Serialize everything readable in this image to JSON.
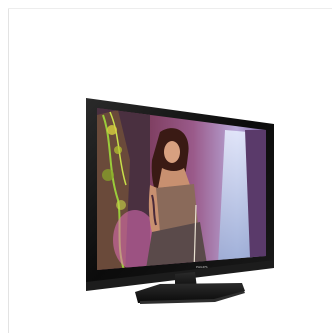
{
  "product": {
    "image_subject": "flat-screen-tv",
    "brand_mark": "PHILIPS"
  },
  "colors": {
    "bezel": "#0d0d0d",
    "stand": "#111111",
    "background": "#ffffff"
  },
  "icons": [
    "tv-icon"
  ]
}
